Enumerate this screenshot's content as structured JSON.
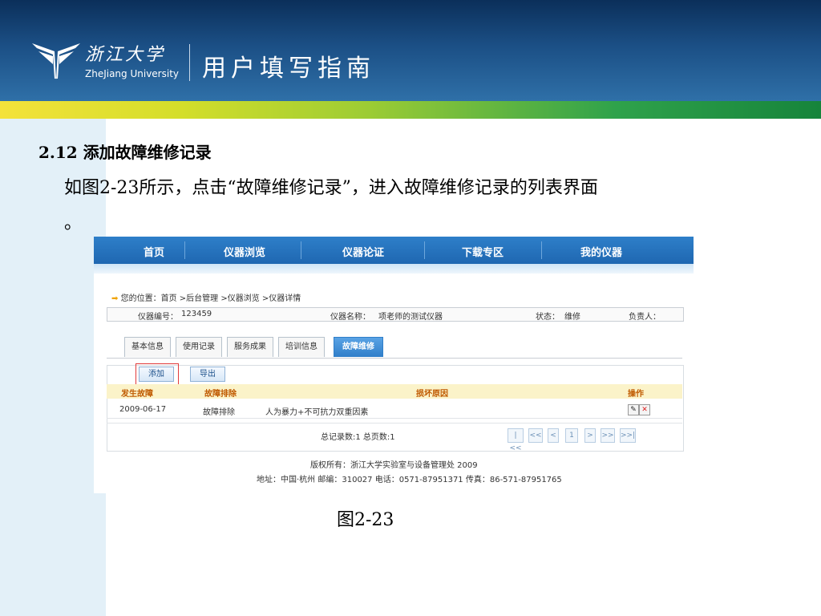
{
  "header": {
    "logo_cn": "浙江大学",
    "logo_en": "ZheJiang University",
    "title": "用户填写指南"
  },
  "slide": {
    "section_title": "2.12 添加故障维修记录",
    "body_line1": "如图2-23所示，点击“故障维修记录”，进入故障维修记录的列表界面",
    "body_line2": "。",
    "caption": "图2-23"
  },
  "screenshot": {
    "nav": [
      "首页",
      "仪器浏览",
      "仪器论证",
      "下载专区",
      "我的仪器"
    ],
    "breadcrumb": "您的位置：首页 >后台管理 >仪器浏览 >仪器详情",
    "info": {
      "number_label": "仪器编号：",
      "number_value": "123459",
      "name_label": "仪器名称：",
      "name_value": "项老师的测试仪器",
      "status_label": "状态：",
      "status_value": "维修",
      "owner_label": "负责人："
    },
    "tabs": [
      "基本信息",
      "使用记录",
      "服务成果",
      "培训信息",
      "故障维修"
    ],
    "active_tab": "故障维修",
    "buttons": {
      "add": "添加",
      "export": "导出"
    },
    "table": {
      "headers": [
        "发生故障",
        "故障排除",
        "损坏原因",
        "操作"
      ],
      "rows": [
        {
          "date": "2009-06-17",
          "status": "故障排除",
          "reason": "人为暴力+不可抗力双重因素"
        }
      ]
    },
    "pager": {
      "summary": "总记录数:1 总页数:1",
      "buttons": [
        "|<<",
        "<<",
        "<",
        "1",
        ">",
        ">>",
        ">>|"
      ]
    },
    "footer": {
      "line1": "版权所有：浙江大学实验室与设备管理处 2009",
      "line2": "地址：中国·杭州 邮编：310027 电话：0571-87951371 传真：86-571-87951765"
    }
  },
  "colors": {
    "header_dark": "#0b2f5a",
    "header_light": "#2f70a8",
    "nav_blue": "#1f67b1",
    "table_header_bg": "#fbf3c9",
    "table_header_text": "#c05a00",
    "highlight_red": "#e23b3b"
  }
}
